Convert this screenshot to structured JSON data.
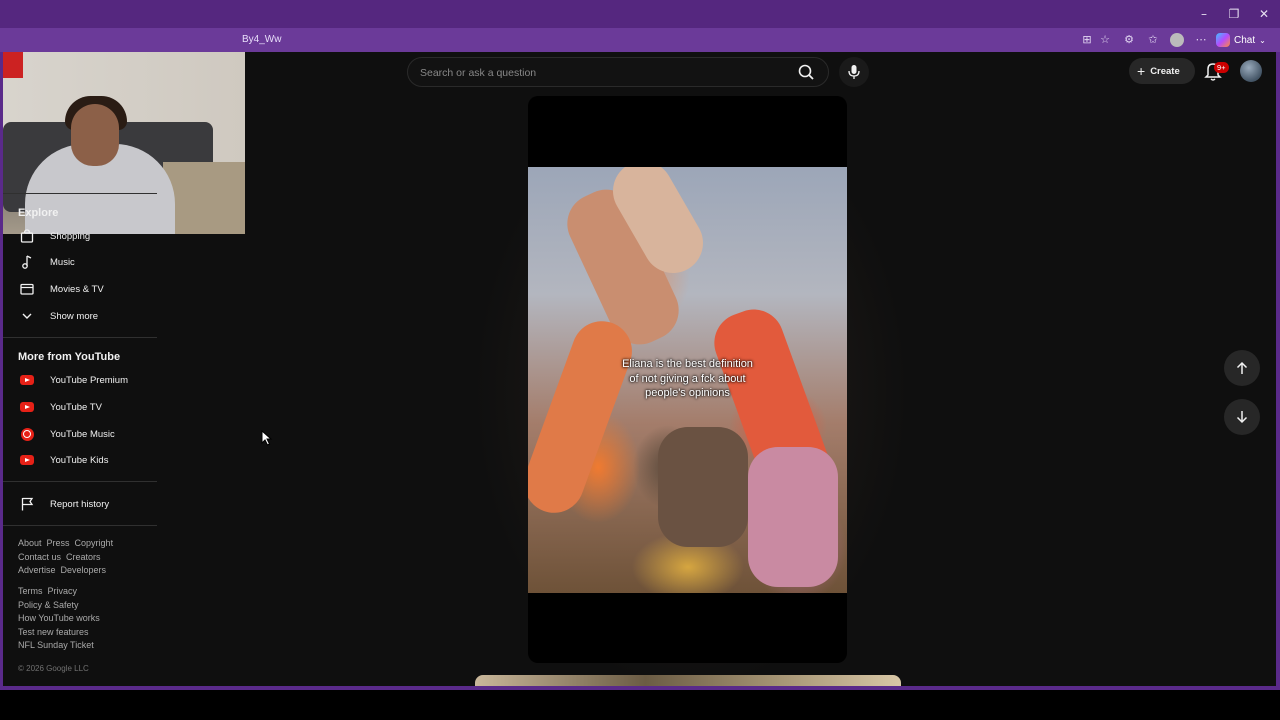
{
  "browser": {
    "url_fragment": "By4_Ww",
    "chat_label": "Chat",
    "colors": {
      "frame": "#5a2a8a",
      "page_bg": "#0f0f0f"
    }
  },
  "header": {
    "search_placeholder": "Search or ask a question",
    "create_label": "Create",
    "notifications_badge": "9+"
  },
  "sidebar": {
    "explore": {
      "title": "Explore",
      "items": [
        {
          "label": "Shopping",
          "icon": "shopping-bag-icon"
        },
        {
          "label": "Music",
          "icon": "music-note-icon"
        },
        {
          "label": "Movies & TV",
          "icon": "clapperboard-icon"
        },
        {
          "label": "Show more",
          "icon": "chevron-down-icon"
        }
      ]
    },
    "more_from_youtube": {
      "title": "More from YouTube",
      "items": [
        {
          "label": "YouTube Premium",
          "icon": "youtube-premium-icon"
        },
        {
          "label": "YouTube TV",
          "icon": "youtube-tv-icon"
        },
        {
          "label": "YouTube Music",
          "icon": "youtube-music-icon"
        },
        {
          "label": "YouTube Kids",
          "icon": "youtube-kids-icon"
        }
      ]
    },
    "report_history": {
      "label": "Report history",
      "icon": "flag-icon"
    },
    "footer": {
      "links_1": [
        "About",
        "Press",
        "Copyright"
      ],
      "links_2": [
        "Contact us",
        "Creators"
      ],
      "links_3": [
        "Advertise",
        "Developers"
      ],
      "links_4": [
        "Terms",
        "Privacy"
      ],
      "links_5": [
        "Policy & Safety"
      ],
      "links_6": [
        "How YouTube works"
      ],
      "links_7": [
        "Test new features"
      ],
      "links_8": [
        "NFL Sunday Ticket"
      ],
      "copyright": "© 2026 Google LLC"
    }
  },
  "short": {
    "caption_line1": "Eliana is the best definition",
    "caption_line2": "of not giving a fck about",
    "caption_line3": "people's opinions"
  }
}
